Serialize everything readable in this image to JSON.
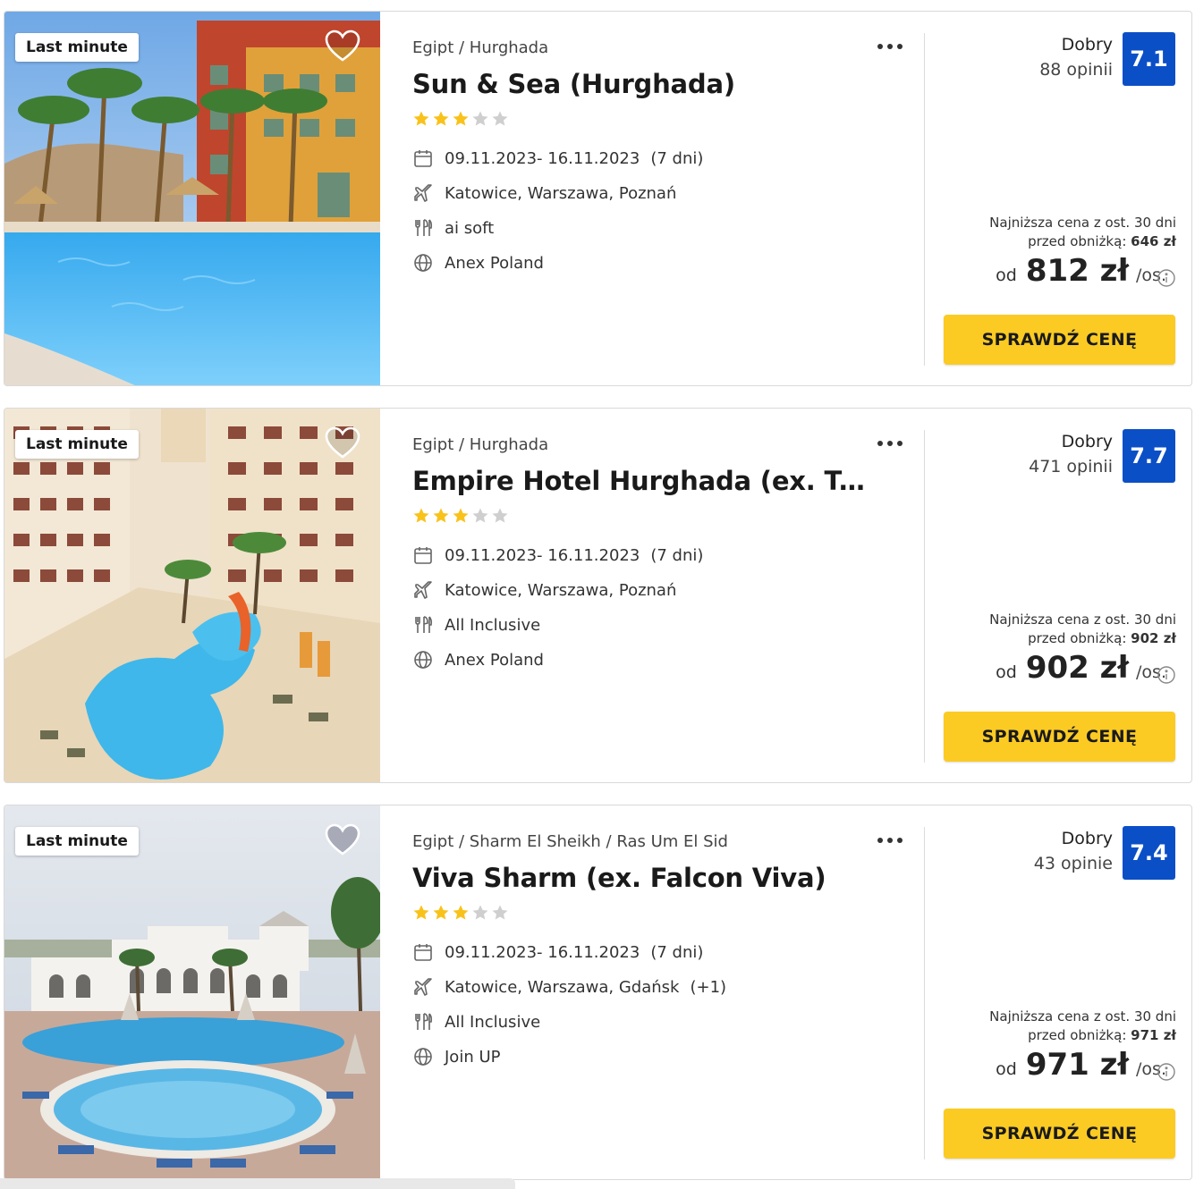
{
  "colors": {
    "accent_yellow": "#fbcb24",
    "score_blue": "#0b4fc7",
    "star_filled": "#f9c21b",
    "star_empty": "#cfcfcf"
  },
  "icons": [
    "heart-icon",
    "more-dots-icon",
    "star-icon",
    "calendar-icon",
    "plane-icon",
    "cutlery-icon",
    "globe-icon",
    "info-icon"
  ],
  "offers": [
    {
      "badge": "Last minute",
      "location": "Egipt / Hurghada",
      "name": "Sun & Sea (Hurghada)",
      "stars": 3,
      "stars_max": 5,
      "dates": "09.11.2023- 16.11.2023",
      "duration": "(7 dni)",
      "airports": "Katowice, Warszawa, Poznań",
      "airports_extra": "",
      "board": "ai soft",
      "operator": "Anex Poland",
      "rating_word": "Dobry",
      "rating_count": "88 opinii",
      "score": "7.1",
      "lowest_line1": "Najniższa cena z ost. 30 dni",
      "lowest_line2": "przed obniżką:",
      "lowest_price": "646 zł",
      "price_prefix": "od",
      "price": "812 zł",
      "price_suffix": "/os.",
      "cta": "SPRAWDŹ CENĘ"
    },
    {
      "badge": "Last minute",
      "location": "Egipt / Hurghada",
      "name": "Empire Hotel Hurghada (ex. Triton E...",
      "stars": 3,
      "stars_max": 5,
      "dates": "09.11.2023- 16.11.2023",
      "duration": "(7 dni)",
      "airports": "Katowice, Warszawa, Poznań",
      "airports_extra": "",
      "board": "All Inclusive",
      "operator": "Anex Poland",
      "rating_word": "Dobry",
      "rating_count": "471 opinii",
      "score": "7.7",
      "lowest_line1": "Najniższa cena z ost. 30 dni",
      "lowest_line2": "przed obniżką:",
      "lowest_price": "902 zł",
      "price_prefix": "od",
      "price": "902 zł",
      "price_suffix": "/os.",
      "cta": "SPRAWDŹ CENĘ"
    },
    {
      "badge": "Last minute",
      "location": "Egipt / Sharm El Sheikh / Ras Um El Sid",
      "name": "Viva Sharm (ex. Falcon Viva)",
      "stars": 3,
      "stars_max": 5,
      "dates": "09.11.2023- 16.11.2023",
      "duration": "(7 dni)",
      "airports": "Katowice, Warszawa, Gdańsk",
      "airports_extra": "(+1)",
      "board": "All Inclusive",
      "operator": "Join UP",
      "rating_word": "Dobry",
      "rating_count": "43 opinie",
      "score": "7.4",
      "lowest_line1": "Najniższa cena z ost. 30 dni",
      "lowest_line2": "przed obniżką:",
      "lowest_price": "971 zł",
      "price_prefix": "od",
      "price": "971 zł",
      "price_suffix": "/os.",
      "cta": "SPRAWDŹ CENĘ"
    }
  ]
}
